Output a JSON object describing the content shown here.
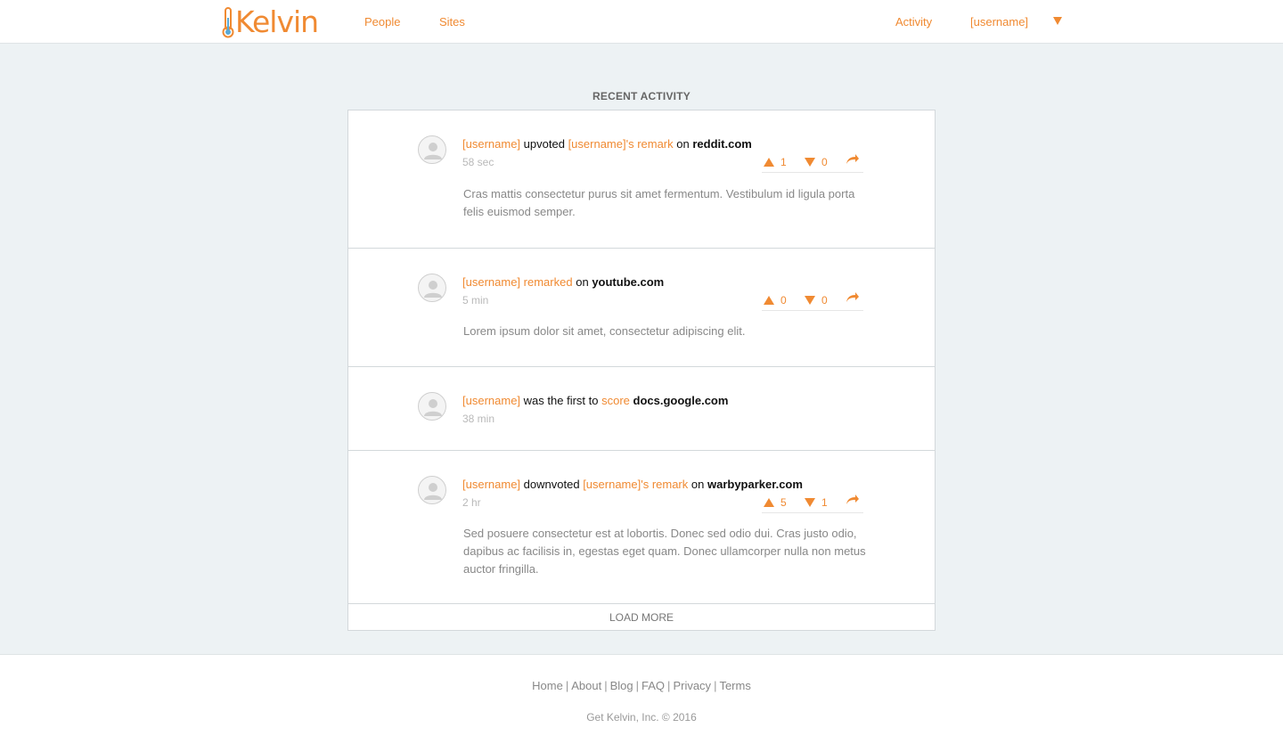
{
  "header": {
    "logo_text": "Kelvin",
    "nav_left": [
      "People",
      "Sites"
    ],
    "nav_activity": "Activity",
    "nav_user": "[username]",
    "menu_icon": "chevron-down-icon",
    "accent_color": "#f08a32"
  },
  "main": {
    "title": "RECENT ACTIVITY",
    "items": [
      {
        "user": "[username]",
        "action": "upvoted",
        "target": "[username]'s remark",
        "connector": "on",
        "site": "reddit.com",
        "time": "58 sec",
        "upvotes": "1",
        "downvotes": "0",
        "text": "Cras mattis consectetur purus sit amet fermentum. Vestibulum id ligula porta felis euismod semper."
      },
      {
        "user": "[username]",
        "action": "remarked",
        "connector": "on",
        "site": "youtube.com",
        "time": "5 min",
        "upvotes": "0",
        "downvotes": "0",
        "text": "Lorem ipsum dolor sit amet, consectetur adipiscing elit."
      },
      {
        "user": "[username]",
        "action": "was the first to",
        "target": "score",
        "site": "docs.google.com",
        "time": "38 min"
      },
      {
        "user": "[username]",
        "action": "downvoted",
        "target": "[username]'s remark",
        "connector": "on",
        "site": "warbyparker.com",
        "time": "2 hr",
        "upvotes": "5",
        "downvotes": "1",
        "text": "Sed posuere consectetur est at lobortis. Donec sed odio dui. Cras justo odio, dapibus ac facilisis in, egestas eget quam. Donec ullamcorper nulla non metus auctor fringilla."
      }
    ],
    "load_more": "LOAD MORE"
  },
  "footer": {
    "links": [
      "Home",
      "About",
      "Blog",
      "FAQ",
      "Privacy",
      "Terms"
    ],
    "copyright": "Get Kelvin, Inc. © 2016"
  }
}
